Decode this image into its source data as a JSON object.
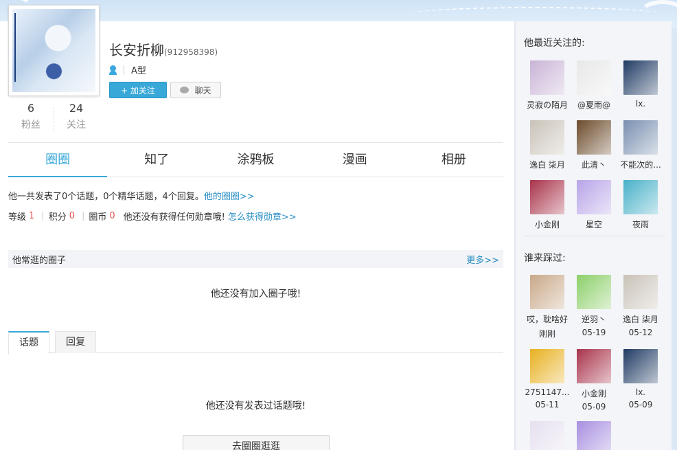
{
  "profile": {
    "name": "长安折柳",
    "uid": "(912958398)",
    "blood_type": "A型",
    "follow_label": "+ 加关注",
    "chat_label": "聊天",
    "fans_count": "6",
    "fans_label": "粉丝",
    "following_count": "24",
    "following_label": "关注"
  },
  "nav": {
    "tabs": [
      "圈圈",
      "知了",
      "涂鸦板",
      "漫画",
      "相册"
    ],
    "active": "圈圈"
  },
  "summary": {
    "text": "他一共发表了0个话题，0个精华话题，4个回复。",
    "link": "他的圈圈>>"
  },
  "levels": {
    "level_label": "等级",
    "level_value": "1",
    "points_label": "积分",
    "points_value": "0",
    "coins_label": "圈币",
    "coins_value": "0",
    "badge_text": "他还没有获得任何勋章哦!",
    "badge_link": "怎么获得勋章>>"
  },
  "circles": {
    "title": "他常逛的圈子",
    "more": "更多>>",
    "empty": "他还没有加入圈子哦!"
  },
  "subtabs": {
    "topics": "话题",
    "replies": "回复",
    "empty": "他还没有发表过话题哦!",
    "goto": "去圈圈逛逛"
  },
  "sidebar": {
    "following_title": "他最近关注的:",
    "following": [
      {
        "name": "灵寂の陌月",
        "color": "#c9b3d6"
      },
      {
        "name": "@夏雨@",
        "color": "#e8e8e8"
      },
      {
        "name": "lx.",
        "color": "#1f3b63"
      },
      {
        "name": "逸白 柒月",
        "color": "#c9c2b8"
      },
      {
        "name": "此清丶",
        "color": "#6b4a2a"
      },
      {
        "name": "不能次的...",
        "color": "#7a8fb0"
      },
      {
        "name": "小金刚",
        "color": "#a8324a"
      },
      {
        "name": "星空",
        "color": "#b8a4e8"
      },
      {
        "name": "夜雨",
        "color": "#48b0c8"
      }
    ],
    "visitors_title": "谁来踩过:",
    "visitors": [
      {
        "name": "哎，耽啥好",
        "date": "刚刚",
        "color": "#c8a888"
      },
      {
        "name": "逆羽丶",
        "date": "05-19",
        "color": "#8ccf6a"
      },
      {
        "name": "逸白 柒月",
        "date": "05-12",
        "color": "#c9c2b8"
      },
      {
        "name": "2751147...",
        "date": "05-11",
        "color": "#e8b020"
      },
      {
        "name": "小金刚",
        "date": "05-09",
        "color": "#a8324a"
      },
      {
        "name": "lx.",
        "date": "05-09",
        "color": "#1f3b63"
      },
      {
        "name": "",
        "date": "",
        "color": "#e6e0ef"
      },
      {
        "name": "",
        "date": "",
        "color": "#a88fe0"
      }
    ]
  }
}
